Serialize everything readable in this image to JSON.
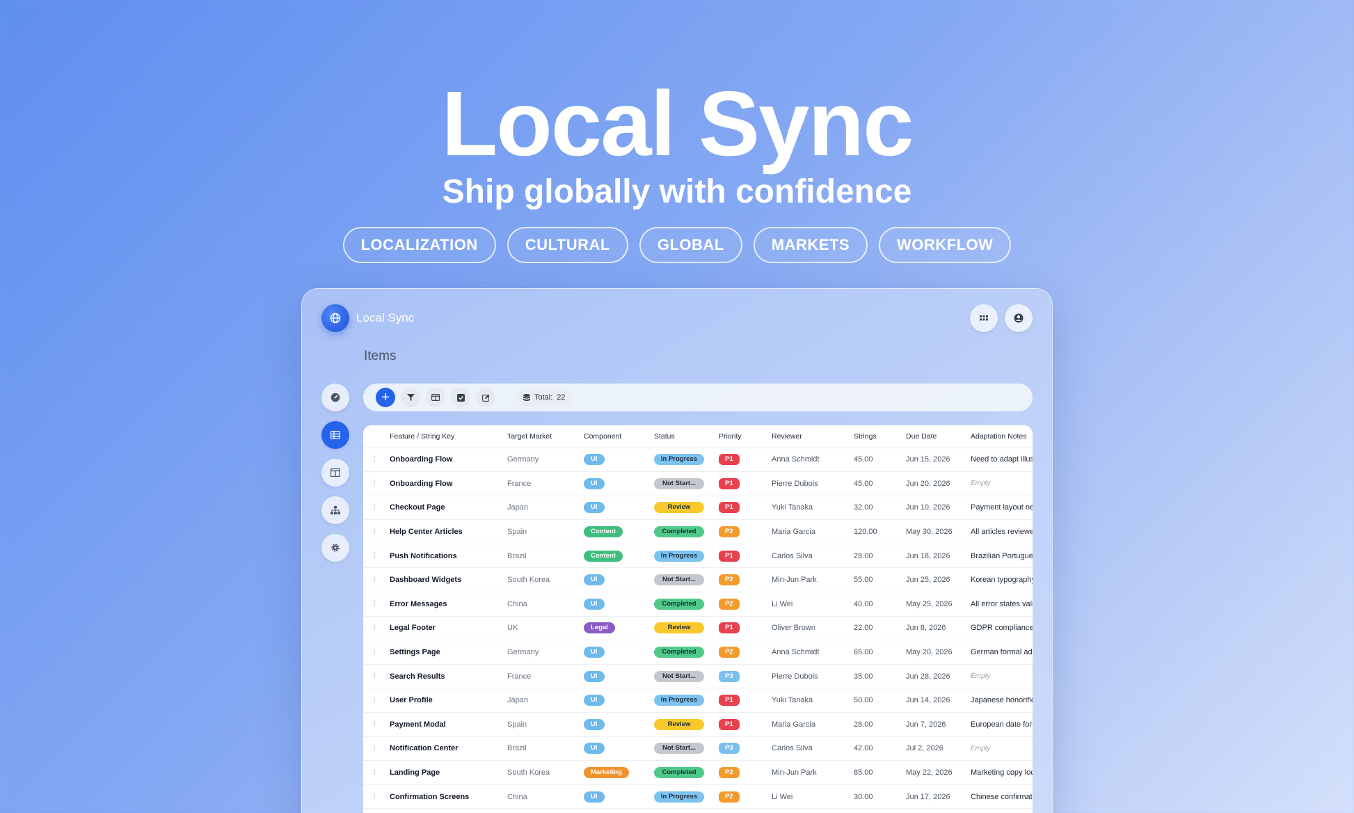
{
  "hero": {
    "title": "Local Sync",
    "subtitle": "Ship globally with confidence",
    "tags": [
      "LOCALIZATION",
      "CULTURAL",
      "GLOBAL",
      "MARKETS",
      "WORKFLOW"
    ]
  },
  "app": {
    "name": "Local Sync",
    "page_title": "Items",
    "sidebar": [
      "dashboard-icon",
      "table-icon",
      "layout-icon",
      "hierarchy-icon",
      "gear-icon"
    ],
    "toolbar": {
      "buttons": [
        "add-icon",
        "filter-icon",
        "columns-icon",
        "checkbox-icon",
        "edit-icon"
      ],
      "total_label": "Total:",
      "total_value": "22"
    }
  },
  "colors": {
    "accent": "#2563eb",
    "comp_UI": "#6fb9ec",
    "comp_Content": "#3fbf7f",
    "comp_Legal": "#8b5cc6",
    "comp_Marketing": "#f0922e",
    "status_In Progress": "#7cc3ef",
    "status_Not Start...": "#c4c7cd",
    "status_Review": "#f7c92a",
    "status_Completed": "#4fc98a",
    "prio_P1": "#e8404e",
    "prio_P2": "#f39a2b",
    "prio_P3": "#79c0ee"
  },
  "table": {
    "columns": [
      "Feature / String Key",
      "Target Market",
      "Component",
      "Status",
      "Priority",
      "Reviewer",
      "Strings",
      "Due Date",
      "Adaptation Notes"
    ],
    "rows": [
      {
        "feature": "Onboarding Flow",
        "market": "Germany",
        "component": "UI",
        "status": "In Progress",
        "priority": "P1",
        "reviewer": "Anna Schmidt",
        "strings": "45.00",
        "due": "Jun 15, 2026",
        "notes": "Need to adapt illus"
      },
      {
        "feature": "Onboarding Flow",
        "market": "France",
        "component": "UI",
        "status": "Not Start...",
        "priority": "P1",
        "reviewer": "Pierre Dubois",
        "strings": "45.00",
        "due": "Jun 20, 2026",
        "notes": "Empty"
      },
      {
        "feature": "Checkout Page",
        "market": "Japan",
        "component": "UI",
        "status": "Review",
        "priority": "P1",
        "reviewer": "Yuki Tanaka",
        "strings": "32.00",
        "due": "Jun 10, 2026",
        "notes": "Payment layout ne"
      },
      {
        "feature": "Help Center Articles",
        "market": "Spain",
        "component": "Content",
        "status": "Completed",
        "priority": "P2",
        "reviewer": "Maria Garcia",
        "strings": "120.00",
        "due": "May 30, 2026",
        "notes": "All articles reviewe"
      },
      {
        "feature": "Push Notifications",
        "market": "Brazil",
        "component": "Content",
        "status": "In Progress",
        "priority": "P1",
        "reviewer": "Carlos Silva",
        "strings": "28.00",
        "due": "Jun 18, 2026",
        "notes": "Brazilian Portugues"
      },
      {
        "feature": "Dashboard Widgets",
        "market": "South Korea",
        "component": "UI",
        "status": "Not Start...",
        "priority": "P2",
        "reviewer": "Min-Jun Park",
        "strings": "55.00",
        "due": "Jun 25, 2026",
        "notes": "Korean typography"
      },
      {
        "feature": "Error Messages",
        "market": "China",
        "component": "UI",
        "status": "Completed",
        "priority": "P2",
        "reviewer": "Li Wei",
        "strings": "40.00",
        "due": "May 25, 2026",
        "notes": "All error states vali"
      },
      {
        "feature": "Legal Footer",
        "market": "UK",
        "component": "Legal",
        "status": "Review",
        "priority": "P1",
        "reviewer": "Oliver Brown",
        "strings": "22.00",
        "due": "Jun 8, 2026",
        "notes": "GDPR compliance"
      },
      {
        "feature": "Settings Page",
        "market": "Germany",
        "component": "UI",
        "status": "Completed",
        "priority": "P2",
        "reviewer": "Anna Schmidt",
        "strings": "65.00",
        "due": "May 20, 2026",
        "notes": "German formal add"
      },
      {
        "feature": "Search Results",
        "market": "France",
        "component": "UI",
        "status": "Not Start...",
        "priority": "P3",
        "reviewer": "Pierre Dubois",
        "strings": "35.00",
        "due": "Jun 28, 2026",
        "notes": "Empty"
      },
      {
        "feature": "User Profile",
        "market": "Japan",
        "component": "UI",
        "status": "In Progress",
        "priority": "P1",
        "reviewer": "Yuki Tanaka",
        "strings": "50.00",
        "due": "Jun 14, 2026",
        "notes": "Japanese honorific"
      },
      {
        "feature": "Payment Modal",
        "market": "Spain",
        "component": "UI",
        "status": "Review",
        "priority": "P1",
        "reviewer": "Maria Garcia",
        "strings": "28.00",
        "due": "Jun 7, 2026",
        "notes": "European date forr"
      },
      {
        "feature": "Notification Center",
        "market": "Brazil",
        "component": "UI",
        "status": "Not Start...",
        "priority": "P3",
        "reviewer": "Carlos Silva",
        "strings": "42.00",
        "due": "Jul 2, 2026",
        "notes": "Empty"
      },
      {
        "feature": "Landing Page",
        "market": "South Korea",
        "component": "Marketing",
        "status": "Completed",
        "priority": "P2",
        "reviewer": "Min-Jun Park",
        "strings": "85.00",
        "due": "May 22, 2026",
        "notes": "Marketing copy loc"
      },
      {
        "feature": "Confirmation Screens",
        "market": "China",
        "component": "UI",
        "status": "In Progress",
        "priority": "P2",
        "reviewer": "Li Wei",
        "strings": "30.00",
        "due": "Jun 17, 2026",
        "notes": "Chinese confirmati"
      }
    ]
  }
}
